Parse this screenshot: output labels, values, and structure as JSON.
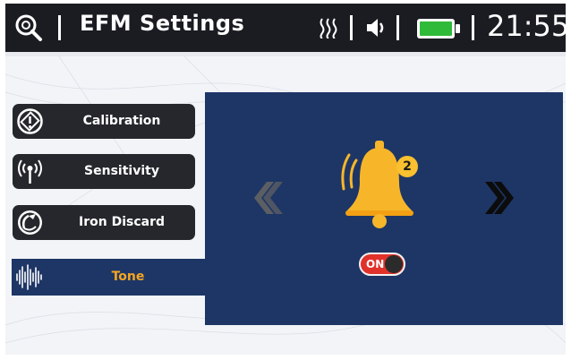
{
  "header": {
    "title": "EFM  Settings",
    "clock": "21:55",
    "icons": [
      "search-icon",
      "heat-icon",
      "volume-icon",
      "battery-icon"
    ],
    "battery_color": "#2fba3a"
  },
  "menu": {
    "items": [
      {
        "label": "Calibration",
        "icon": "calibration-icon"
      },
      {
        "label": "Sensitivity",
        "icon": "sensitivity-icon"
      },
      {
        "label": "Iron Discard",
        "icon": "iron-discard-icon"
      },
      {
        "label": "Tone",
        "icon": "tone-icon"
      }
    ],
    "active_color": "#f6a51f"
  },
  "panel": {
    "tone_number": "2",
    "toggle_label": "ON",
    "accent": "#1e3666",
    "bell_color": "#f7b62a",
    "toggle_color": "#e0322b"
  }
}
